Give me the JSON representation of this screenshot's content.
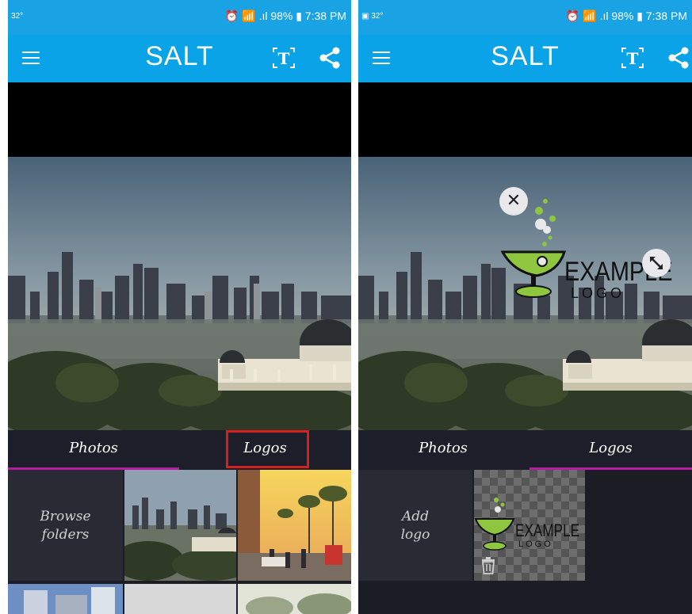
{
  "panels": [
    {
      "status": {
        "left": "32°",
        "right": "⏰ 📶 .ıl 98% ▮ 7:38 PM"
      },
      "appbar": {
        "title": "SALT"
      },
      "tabs": {
        "photos": "Photos",
        "logos": "Logos",
        "active": "photos"
      },
      "grid": {
        "browse_label": "Browse folders"
      }
    },
    {
      "status": {
        "left": "▣ 32°",
        "right": "⏰ 📶 .ıl 98% ▮ 7:38 PM"
      },
      "appbar": {
        "title": "SALT"
      },
      "tabs": {
        "photos": "Photos",
        "logos": "Logos",
        "active": "logos"
      },
      "overlay_logo": {
        "line1": "EXAMPLE",
        "line2": "LOGO"
      },
      "grid": {
        "add_label": "Add logo",
        "thumb_line1": "EXAMPLE",
        "thumb_line2": "LOGO"
      }
    }
  ],
  "colors": {
    "appbar": "#0ba3e8",
    "tab_indicator": "#b01e9e",
    "highlight": "#d81e1e",
    "panel_bg": "#1c1c24"
  },
  "icons": [
    "menu-icon",
    "text-tool-icon",
    "share-icon",
    "close-icon",
    "resize-icon",
    "trash-icon"
  ]
}
